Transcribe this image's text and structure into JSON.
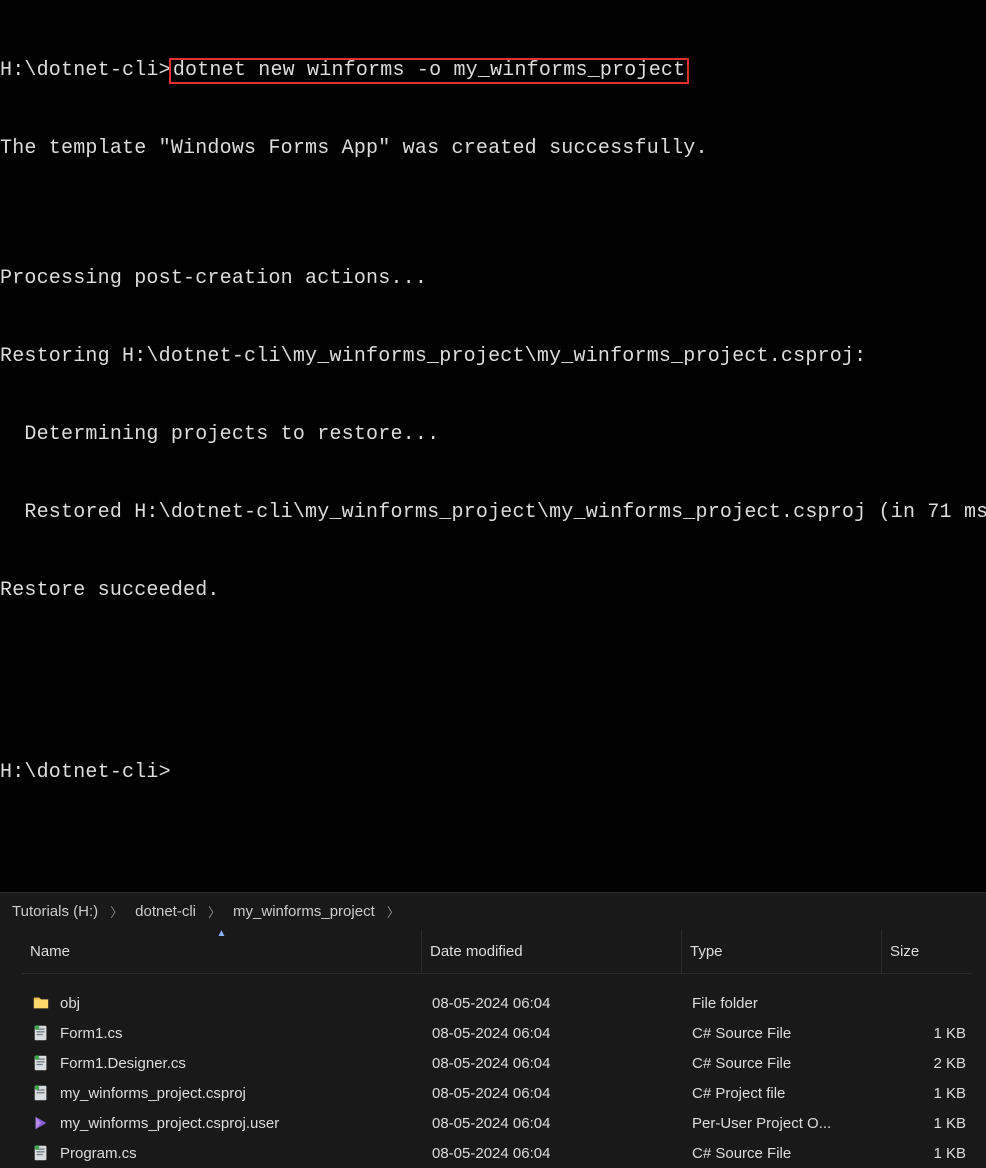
{
  "terminal": {
    "prompt1": "H:\\dotnet-cli>",
    "command": "dotnet new winforms -o my_winforms_project",
    "lines": [
      "The template \"Windows Forms App\" was created successfully.",
      "",
      "Processing post-creation actions...",
      "Restoring H:\\dotnet-cli\\my_winforms_project\\my_winforms_project.csproj:",
      "  Determining projects to restore...",
      "  Restored H:\\dotnet-cli\\my_winforms_project\\my_winforms_project.csproj (in 71 ms",
      "Restore succeeded.",
      "",
      "",
      "H:\\dotnet-cli>"
    ]
  },
  "explorer": {
    "breadcrumb": [
      "Tutorials (H:)",
      "dotnet-cli",
      "my_winforms_project"
    ],
    "columns": {
      "name": "Name",
      "date": "Date modified",
      "type": "Type",
      "size": "Size"
    },
    "rows": [
      {
        "icon": "folder",
        "name": "obj",
        "date": "08-05-2024 06:04",
        "type": "File folder",
        "size": ""
      },
      {
        "icon": "csfile",
        "name": "Form1.cs",
        "date": "08-05-2024 06:04",
        "type": "C# Source File",
        "size": "1 KB"
      },
      {
        "icon": "csfile",
        "name": "Form1.Designer.cs",
        "date": "08-05-2024 06:04",
        "type": "C# Source File",
        "size": "2 KB"
      },
      {
        "icon": "csproj",
        "name": "my_winforms_project.csproj",
        "date": "08-05-2024 06:04",
        "type": "C# Project file",
        "size": "1 KB"
      },
      {
        "icon": "vsuser",
        "name": "my_winforms_project.csproj.user",
        "date": "08-05-2024 06:04",
        "type": "Per-User Project O...",
        "size": "1 KB"
      },
      {
        "icon": "csfile",
        "name": "Program.cs",
        "date": "08-05-2024 06:04",
        "type": "C# Source File",
        "size": "1 KB"
      }
    ]
  }
}
